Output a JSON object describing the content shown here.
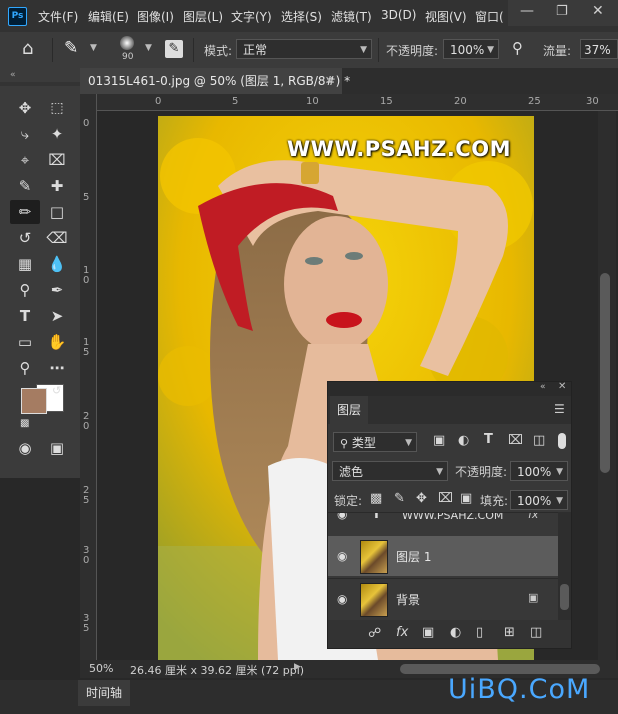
{
  "app": {
    "logo": "Ps"
  },
  "menu": [
    "文件(F)",
    "编辑(E)",
    "图像(I)",
    "图层(L)",
    "文字(Y)",
    "选择(S)",
    "滤镜(T)",
    "3D(D)",
    "视图(V)",
    "窗口("
  ],
  "options": {
    "brush_size": "90",
    "mode_label": "模式:",
    "mode_value": "正常",
    "opacity_label": "不透明度:",
    "opacity_value": "100%",
    "flow_label": "流量:",
    "flow_value": "37%"
  },
  "document": {
    "tab_title": "01315L461-0.jpg @ 50% (图层 1, RGB/8#) *",
    "zoom": "50%",
    "size_info": "26.46 厘米 x 39.62 厘米 (72 ppi)",
    "watermark": "WWW.PSAHZ.COM"
  },
  "rulers": {
    "h": [
      "0",
      "5",
      "10",
      "15",
      "20",
      "25",
      "30"
    ],
    "v": [
      "0",
      "5",
      "1 0",
      "1 5",
      "2 0",
      "2 5",
      "3 0",
      "3 5"
    ]
  },
  "layers_panel": {
    "tab": "图层",
    "filter_value": "类型",
    "blend_mode": "滤色",
    "opacity_label": "不透明度:",
    "opacity_value": "100%",
    "lock_label": "锁定:",
    "fill_label": "填充:",
    "fill_value": "100%",
    "layers": [
      {
        "name": "WWW.PSAHZ.COM",
        "type": "text"
      },
      {
        "name": "图层 1",
        "type": "pixel",
        "selected": true
      },
      {
        "name": "背景",
        "type": "background",
        "locked": true
      }
    ]
  },
  "bottom": {
    "timeline_tab": "时间轴",
    "brand": "UiBQ.CoM"
  },
  "colors": {
    "foreground": "#a57c62",
    "background": "#ffffff",
    "accent": "#31a8ff"
  }
}
